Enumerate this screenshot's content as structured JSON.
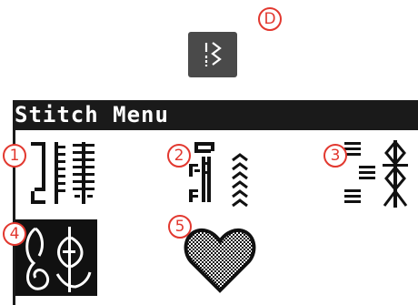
{
  "header": {
    "key_icon": "stitch-menu-key-icon",
    "key_label": "D"
  },
  "menu": {
    "title": "Stitch Menu",
    "categories": [
      {
        "label": "1",
        "icon": "utility-stitches-icon"
      },
      {
        "label": "2",
        "icon": "buttonhole-stitches-icon"
      },
      {
        "label": "3",
        "icon": "decorative-stitches-icon"
      },
      {
        "label": "4",
        "icon": "embroidery-stitches-icon",
        "selected": true
      },
      {
        "label": "5",
        "icon": "heart-stitches-icon"
      }
    ]
  },
  "colors": {
    "callout": "#e2382f",
    "screen_dark": "#1a1a1a",
    "key_bg": "#4a4a4a"
  }
}
